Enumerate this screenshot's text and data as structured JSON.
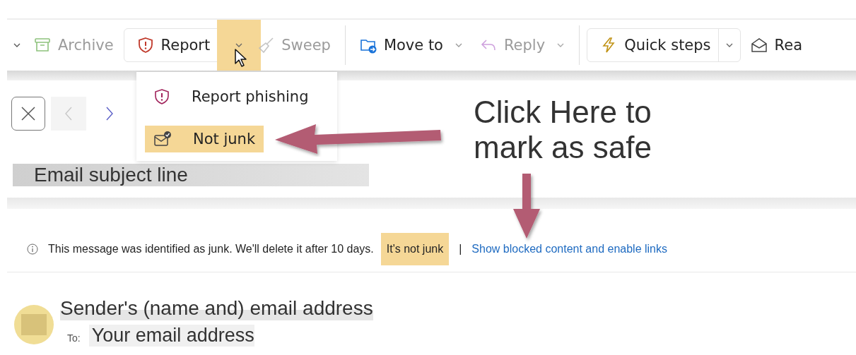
{
  "toolbar": {
    "items": [
      {
        "kind": "overflow"
      },
      {
        "kind": "archive",
        "label": "Archive",
        "disabled": true
      },
      {
        "kind": "report",
        "label": "Report",
        "disabled": false,
        "split": true,
        "menu_open": true
      },
      {
        "kind": "sweep",
        "label": "Sweep",
        "disabled": true
      },
      {
        "kind": "move",
        "label": "Move to",
        "disabled": false,
        "dropdown": true
      },
      {
        "kind": "reply",
        "label": "Reply",
        "disabled": true,
        "dropdown": true
      },
      {
        "kind": "quick",
        "label": "Quick steps",
        "disabled": false,
        "split": true
      },
      {
        "kind": "read",
        "label": "Rea",
        "disabled": false
      }
    ]
  },
  "report_menu": {
    "items": [
      {
        "kind": "phishing",
        "label": "Report phishing",
        "highlighted": false
      },
      {
        "kind": "notjunk",
        "label": "Not junk",
        "highlighted": true
      }
    ]
  },
  "annotation": {
    "text": "Click Here to mark as safe"
  },
  "navigation": {
    "previous_disabled": true,
    "next_disabled": false
  },
  "subject": "Email subject line",
  "junk_bar": {
    "message": "This message was identified as junk. We'll delete it after 10 days.",
    "not_junk_link": "It's not junk",
    "not_junk_highlighted": true,
    "separator": "|",
    "blocked_link": "Show blocked content and enable links"
  },
  "sender": {
    "name": "Sender's (name and) email address",
    "to_label": "To:",
    "to": "Your email address"
  }
}
